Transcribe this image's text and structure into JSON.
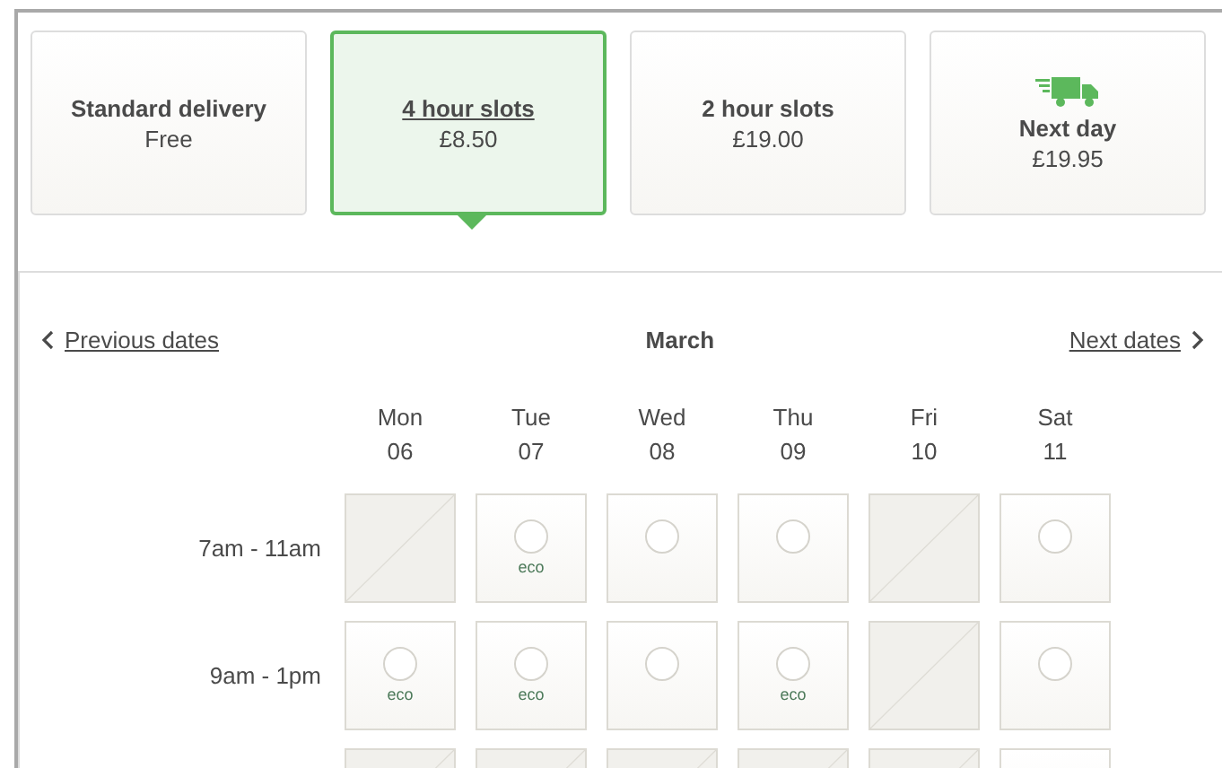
{
  "delivery_options": [
    {
      "title": "Standard delivery",
      "price": "Free",
      "selected": false,
      "kind": "plain"
    },
    {
      "title": "4 hour slots",
      "price": "£8.50",
      "selected": true,
      "kind": "plain"
    },
    {
      "title": "2 hour slots",
      "price": "£19.00",
      "selected": false,
      "kind": "plain"
    },
    {
      "title": "Next day",
      "price": "£19.95",
      "selected": false,
      "kind": "express"
    }
  ],
  "calendar": {
    "previous": "Previous dates",
    "month": "March",
    "next": "Next dates",
    "days": [
      {
        "name": "Mon",
        "date": "06"
      },
      {
        "name": "Tue",
        "date": "07"
      },
      {
        "name": "Wed",
        "date": "08"
      },
      {
        "name": "Thu",
        "date": "09"
      },
      {
        "name": "Fri",
        "date": "10"
      },
      {
        "name": "Sat",
        "date": "11"
      }
    ],
    "rows": [
      {
        "time": "7am - 11am",
        "slots": [
          {
            "available": false
          },
          {
            "available": true,
            "tag": "eco"
          },
          {
            "available": true
          },
          {
            "available": true
          },
          {
            "available": false
          },
          {
            "available": true
          }
        ]
      },
      {
        "time": "9am - 1pm",
        "slots": [
          {
            "available": true,
            "tag": "eco"
          },
          {
            "available": true,
            "tag": "eco"
          },
          {
            "available": true
          },
          {
            "available": true,
            "tag": "eco"
          },
          {
            "available": false
          },
          {
            "available": true
          }
        ]
      },
      {
        "slots": [
          {
            "available": false
          },
          {
            "available": false
          },
          {
            "available": false
          },
          {
            "available": false
          },
          {
            "available": false
          },
          {
            "available": true
          }
        ]
      }
    ]
  }
}
